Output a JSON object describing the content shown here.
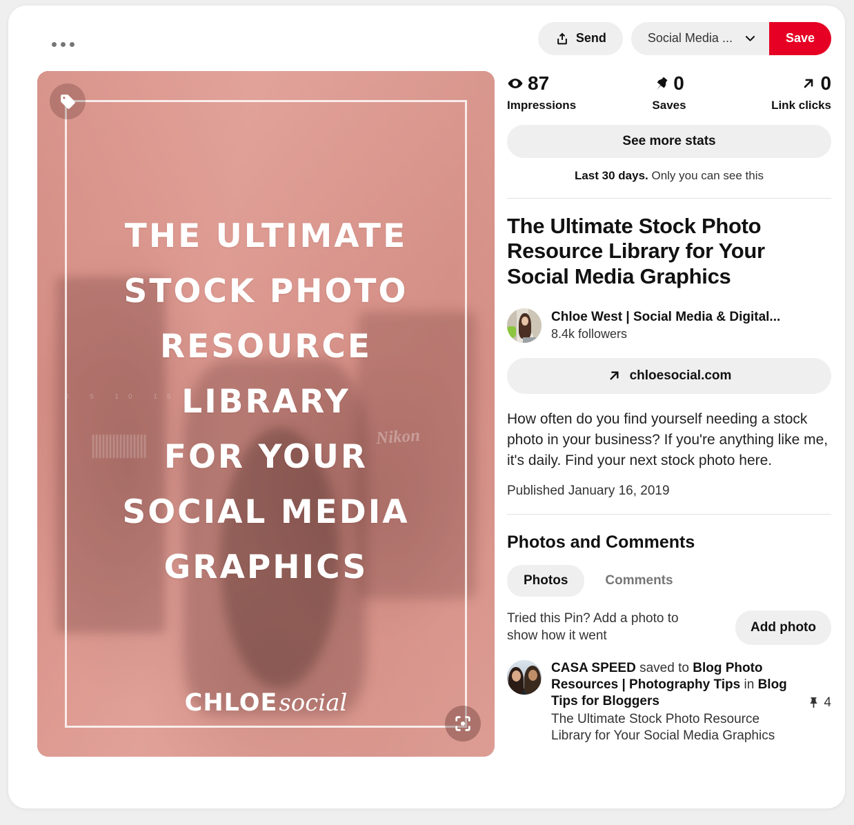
{
  "toolbar": {
    "more_label": "more-options",
    "send_label": "Send",
    "board_label": "Social Media ...",
    "save_label": "Save"
  },
  "stats": {
    "items": [
      {
        "value": "87",
        "label": "Impressions",
        "icon": "eye-icon"
      },
      {
        "value": "0",
        "label": "Saves",
        "icon": "pin-icon"
      },
      {
        "value": "0",
        "label": "Link clicks",
        "icon": "arrow-up-right-icon"
      }
    ],
    "see_more_label": "See more stats",
    "note_bold": "Last 30 days.",
    "note_rest": " Only you can see this"
  },
  "pin": {
    "title": "The Ultimate Stock Photo Resource Library for Your Social Media Graphics",
    "author_name": "Chloe West | Social Media & Digital...",
    "author_followers": "8.4k followers",
    "link_label": "chloesocial.com",
    "description": "How often do you find yourself needing a stock photo in your business? If you're anything like me, it's daily. Find your next stock photo here.",
    "published": "Published January 16, 2019"
  },
  "pin_image": {
    "headline_lines": [
      "THE ULTIMATE",
      "STOCK PHOTO",
      "RESOURCE",
      "LIBRARY",
      "FOR YOUR",
      "SOCIAL MEDIA",
      "GRAPHICS"
    ],
    "logo_bold": "CHLOE",
    "logo_script": "social",
    "camera_brand": "Nikon",
    "camera_ticks": "0 5 10 15",
    "tag_icon": "tag-icon",
    "lens_icon": "visual-search-icon"
  },
  "photos_comments": {
    "section_title": "Photos and Comments",
    "tabs": [
      {
        "label": "Photos",
        "active": true
      },
      {
        "label": "Comments",
        "active": false
      }
    ],
    "tried_text": "Tried this Pin? Add a photo to show how it went",
    "add_photo_label": "Add photo"
  },
  "activity": {
    "user": "CASA SPEED",
    "saved_to_text": " saved to ",
    "board": "Blog Photo Resources | Photography Tips",
    "in_text": " in ",
    "parent_board": "Blog Tips for Bloggers",
    "subtitle": "The Ultimate Stock Photo Resource Library for Your Social Media Graphics",
    "pin_count": "4"
  },
  "colors": {
    "brand_red": "#e60023",
    "page_bg": "#efefef",
    "card_bg": "#ffffff",
    "chip_bg": "#efefef",
    "text_primary": "#111111",
    "text_secondary": "#767676",
    "pin_image_bg": "#cf9289"
  }
}
